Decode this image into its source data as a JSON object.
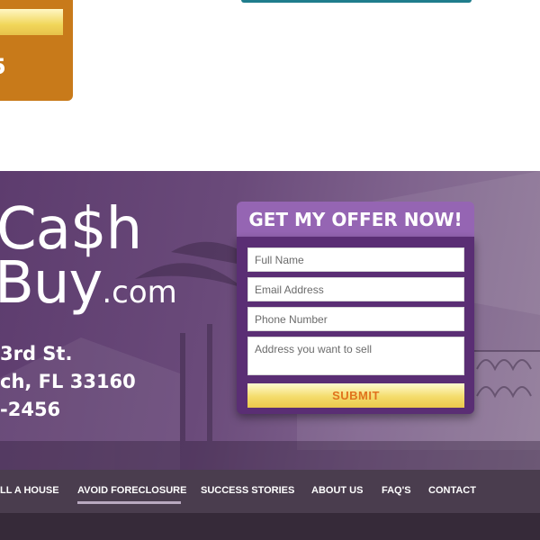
{
  "top_card": {
    "digit": "5"
  },
  "logo": {
    "line1": "Ca$h",
    "line2": "Buy",
    "suffix": ".com"
  },
  "contact": {
    "street": "3rd St.",
    "city": "ch, FL 33160",
    "phone": "-2456"
  },
  "offer_form": {
    "title": "GET MY OFFER NOW!",
    "full_name_placeholder": "Full Name",
    "email_placeholder": "Email Address",
    "phone_placeholder": "Phone Number",
    "address_placeholder": "Address you want to sell",
    "submit_label": "SUBMIT"
  },
  "nav": {
    "items": [
      {
        "label": "LL A HOUSE"
      },
      {
        "label": "AVOID FORECLOSURE"
      },
      {
        "label": "SUCCESS STORIES"
      },
      {
        "label": "ABOUT US"
      },
      {
        "label": "FAQ'S"
      },
      {
        "label": "CONTACT"
      }
    ],
    "active_index": 1
  },
  "colors": {
    "brand_purple": "#5a2e74",
    "header_purple": "#9565b3",
    "accent_orange": "#e0731d",
    "card_orange": "#c87a1a"
  }
}
